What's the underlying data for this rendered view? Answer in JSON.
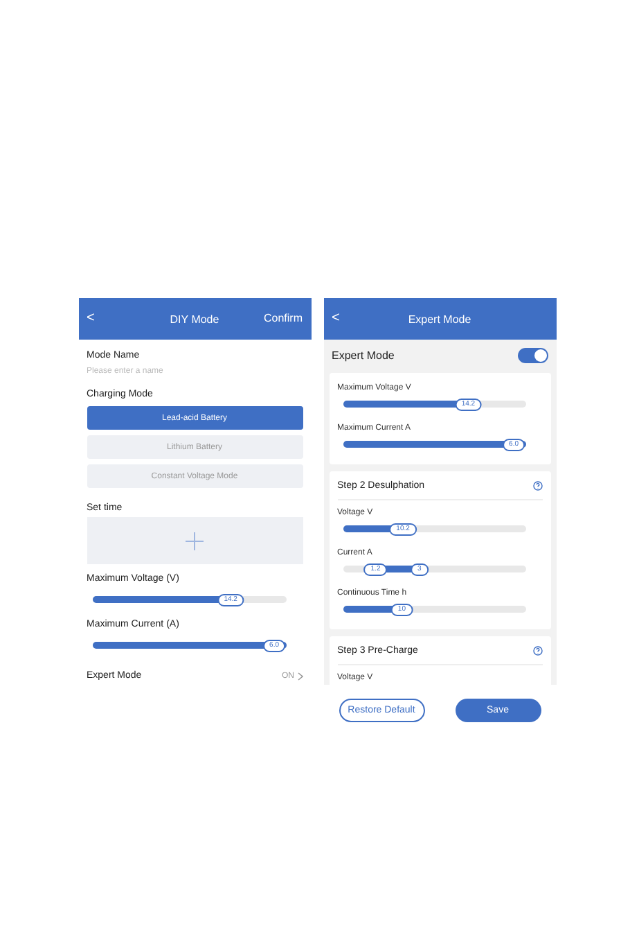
{
  "diy_screen": {
    "back": "<",
    "title": "DIY Mode",
    "confirm": "Confirm",
    "mode_name": {
      "label": "Mode Name",
      "placeholder": "Please enter a name"
    },
    "charging_mode": {
      "label": "Charging Mode",
      "options": [
        {
          "label": "Lead-acid Battery",
          "selected": true
        },
        {
          "label": "Lithium Battery",
          "selected": false
        },
        {
          "label": "Constant Voltage Mode",
          "selected": false
        }
      ]
    },
    "set_time": {
      "label": "Set time"
    },
    "sliders": [
      {
        "label": "Maximum Voltage (V)",
        "level": 0.75,
        "reading": "14.2"
      },
      {
        "label": "Maximum Current (A)",
        "level": 1.0,
        "reading": "6.0"
      }
    ],
    "expert_mode": {
      "label": "Expert Mode",
      "value": "ON"
    }
  },
  "expert_screen": {
    "back": "<",
    "title": "Expert Mode",
    "toggle": {
      "label": "Expert Mode",
      "on": true
    },
    "cards": [
      {
        "sliders": [
          {
            "label": "Maximum Voltage V",
            "thumbs": [
              {
                "level": 0.72,
                "reading": "14.2"
              }
            ]
          },
          {
            "label": "Maximum Current A",
            "thumbs": [
              {
                "level": 1.0,
                "reading": "6.0"
              }
            ]
          }
        ]
      },
      {
        "title": "Step 2 Desulphation",
        "sliders": [
          {
            "label": "Voltage V",
            "thumbs": [
              {
                "level": 0.3,
                "reading": "10.2"
              }
            ]
          },
          {
            "label": "Current A",
            "thumbs": [
              {
                "level": 0.18,
                "reading": "1.2"
              },
              {
                "level": 0.42,
                "reading": "3"
              }
            ]
          },
          {
            "label": "Continuous Time h",
            "thumbs": [
              {
                "level": 0.3,
                "reading": "10"
              }
            ]
          }
        ]
      },
      {
        "title": "Step 3 Pre-Charge",
        "sliders": [
          {
            "label": "Voltage V"
          }
        ]
      }
    ],
    "buttons": [
      {
        "label": "Restore Default",
        "kind": "outline"
      },
      {
        "label": "Save",
        "kind": "filled"
      }
    ]
  }
}
